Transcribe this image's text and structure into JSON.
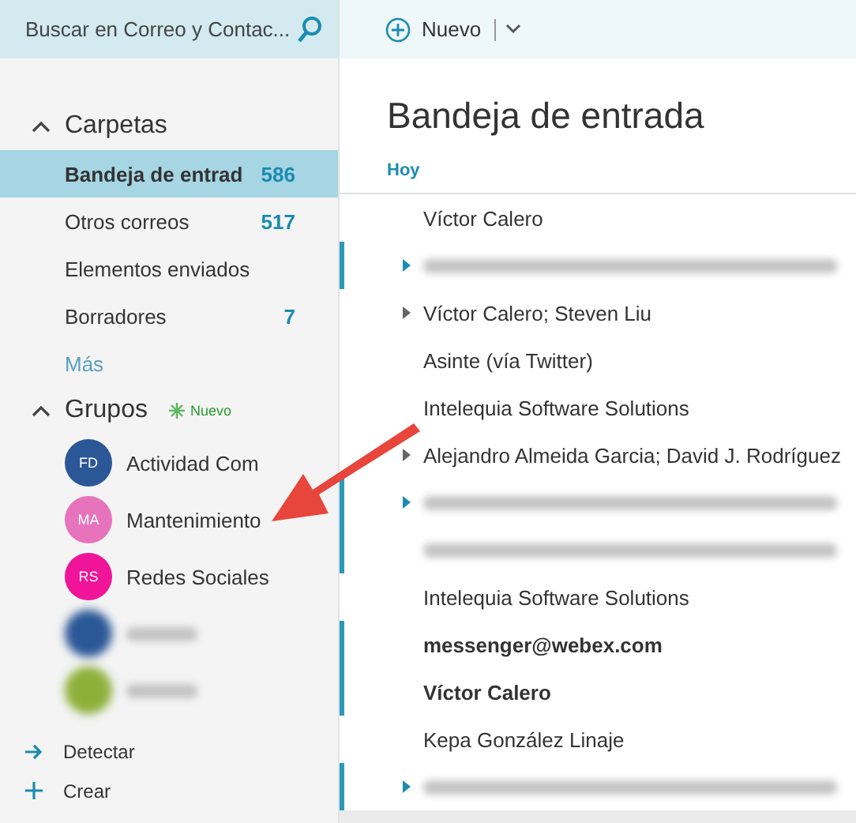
{
  "search": {
    "placeholder": "Buscar en Correo y Contac..."
  },
  "toolbar": {
    "new_label": "Nuevo"
  },
  "sidebar": {
    "folders_heading": "Carpetas",
    "folders_expanded": true,
    "folders": [
      {
        "name": "Bandeja de entrad",
        "count": "586",
        "selected": true
      },
      {
        "name": "Otros correos",
        "count": "517",
        "selected": false
      },
      {
        "name": "Elementos enviados",
        "selected": false
      },
      {
        "name": "Borradores",
        "count": "7",
        "selected": false
      }
    ],
    "more": "Más",
    "groups_heading": "Grupos",
    "groups_expanded": true,
    "groups_badge": "Nuevo",
    "groups": [
      {
        "kind": "named",
        "initials": "FD",
        "name": "Actividad Com",
        "color": "#2b5797"
      },
      {
        "kind": "named",
        "initials": "MA",
        "name": "Mantenimiento",
        "color": "#e773bd"
      },
      {
        "kind": "named",
        "initials": "RS",
        "name": "Redes Sociales",
        "color": "#f0149a"
      },
      {
        "kind": "redacted",
        "color": "#2b5797"
      },
      {
        "kind": "redacted",
        "color": "#8cb03a"
      }
    ],
    "actions": [
      {
        "kind": "discover",
        "label": "Detectar"
      },
      {
        "kind": "create",
        "label": "Crear"
      }
    ]
  },
  "inbox": {
    "title": "Bandeja de entrada",
    "section": "Hoy",
    "messages": [
      {
        "kind": "text",
        "sender": "Víctor Calero",
        "unread": false,
        "thread": false
      },
      {
        "kind": "redacted",
        "unread": true,
        "thread": true
      },
      {
        "kind": "text",
        "sender": "Víctor Calero; Steven Liu",
        "unread": false,
        "thread": true
      },
      {
        "kind": "text",
        "sender": "Asinte (vía Twitter)",
        "unread": false,
        "thread": false
      },
      {
        "kind": "text",
        "sender": "Intelequia Software Solutions",
        "unread": false,
        "thread": false
      },
      {
        "kind": "text",
        "sender": "Alejandro Almeida Garcia; David J. Rodríguez",
        "unread": false,
        "thread": true
      },
      {
        "kind": "redacted",
        "unread": true,
        "thread": true
      },
      {
        "kind": "redacted",
        "unread": true,
        "thread": false
      },
      {
        "kind": "text",
        "sender": "Intelequia Software Solutions",
        "unread": false,
        "thread": false
      },
      {
        "kind": "text",
        "sender": "messenger@webex.com",
        "unread": true,
        "thread": false
      },
      {
        "kind": "text",
        "sender": "Víctor Calero",
        "unread": true,
        "thread": false
      },
      {
        "kind": "text",
        "sender": "Kepa González Linaje",
        "unread": false,
        "thread": false
      },
      {
        "kind": "redacted",
        "unread": true,
        "thread": true
      }
    ]
  }
}
